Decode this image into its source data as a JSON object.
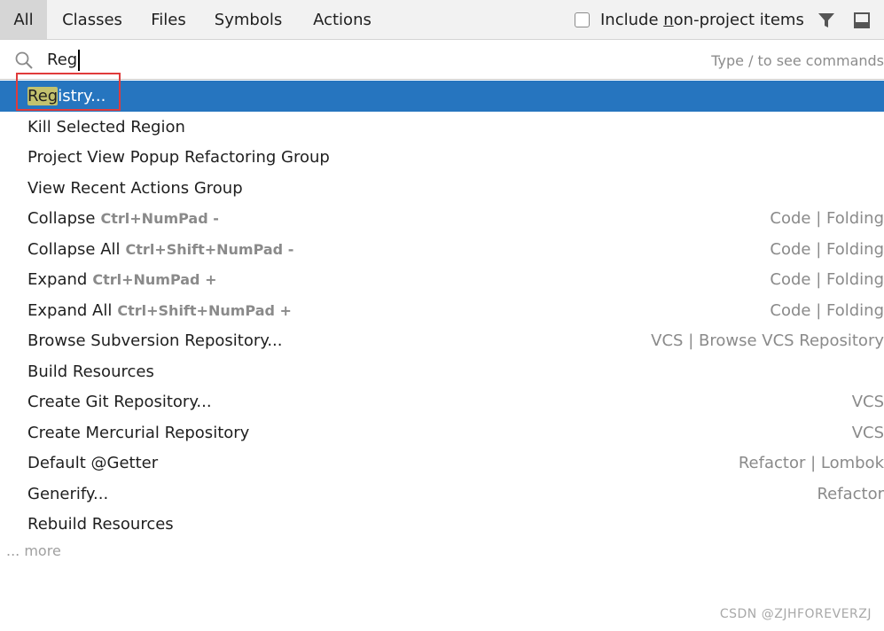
{
  "tabs": [
    {
      "label": "All",
      "active": true
    },
    {
      "label": "Classes",
      "active": false
    },
    {
      "label": "Files",
      "active": false
    },
    {
      "label": "Symbols",
      "active": false
    },
    {
      "label": "Actions",
      "active": false
    }
  ],
  "toolbar": {
    "include_label_pre": "Include ",
    "include_label_u": "n",
    "include_label_post": "on-project items",
    "include_checked": false,
    "filter_icon": "filter-icon",
    "pin_icon": "pin-window-icon"
  },
  "search": {
    "icon": "search-icon",
    "value": "Reg",
    "hint": "Type / to see commands"
  },
  "results": [
    {
      "match": "Reg",
      "rest": "istry...",
      "shortcut": "",
      "group": "",
      "selected": true
    },
    {
      "match": "",
      "rest": "Kill Selected Region",
      "shortcut": "",
      "group": "",
      "selected": false
    },
    {
      "match": "",
      "rest": "Project View Popup Refactoring Group",
      "shortcut": "",
      "group": "",
      "selected": false
    },
    {
      "match": "",
      "rest": "View Recent Actions Group",
      "shortcut": "",
      "group": "",
      "selected": false
    },
    {
      "match": "",
      "rest": "Collapse",
      "shortcut": "Ctrl+NumPad -",
      "group": "Code | Folding",
      "selected": false
    },
    {
      "match": "",
      "rest": "Collapse All",
      "shortcut": "Ctrl+Shift+NumPad -",
      "group": "Code | Folding",
      "selected": false
    },
    {
      "match": "",
      "rest": "Expand",
      "shortcut": "Ctrl+NumPad +",
      "group": "Code | Folding",
      "selected": false
    },
    {
      "match": "",
      "rest": "Expand All",
      "shortcut": "Ctrl+Shift+NumPad +",
      "group": "Code | Folding",
      "selected": false
    },
    {
      "match": "",
      "rest": "Browse Subversion Repository...",
      "shortcut": "",
      "group": "VCS | Browse VCS Repository",
      "selected": false
    },
    {
      "match": "",
      "rest": "Build Resources",
      "shortcut": "",
      "group": "",
      "selected": false
    },
    {
      "match": "",
      "rest": "Create Git Repository...",
      "shortcut": "",
      "group": "VCS",
      "selected": false
    },
    {
      "match": "",
      "rest": "Create Mercurial Repository",
      "shortcut": "",
      "group": "VCS",
      "selected": false
    },
    {
      "match": "",
      "rest": "Default @Getter",
      "shortcut": "",
      "group": "Refactor | Lombok",
      "selected": false
    },
    {
      "match": "",
      "rest": "Generify...",
      "shortcut": "",
      "group": "Refactor",
      "selected": false
    },
    {
      "match": "",
      "rest": "Rebuild Resources",
      "shortcut": "",
      "group": "",
      "selected": false
    }
  ],
  "more_label": "... more",
  "watermark": "CSDN @ZJHFOREVERZJ",
  "colors": {
    "selection": "#2675bf",
    "match_highlight": "#c3c26e",
    "annotation_box": "#e03b3b"
  }
}
